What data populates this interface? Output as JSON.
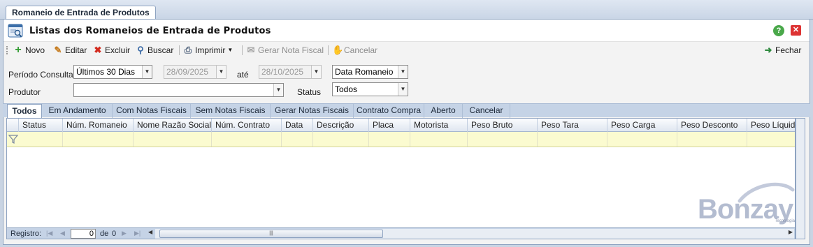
{
  "doc_tab": "Romaneio de Entrada de Produtos",
  "window": {
    "title": "Listas dos Romaneios de Entrada de Produtos"
  },
  "toolbar": {
    "novo": "Novo",
    "editar": "Editar",
    "excluir": "Excluir",
    "buscar": "Buscar",
    "imprimir": "Imprimir",
    "gerar_nf": "Gerar Nota Fiscal",
    "cancelar": "Cancelar",
    "fechar": "Fechar"
  },
  "filters": {
    "periodo_label": "Período Consulta",
    "periodo_value": "Últimos 30 Dias",
    "date_from": "28/09/2025",
    "ate_label": "até",
    "date_to": "28/10/2025",
    "date_type": "Data Romaneio",
    "produtor_label": "Produtor",
    "produtor_value": "",
    "status_label": "Status",
    "status_value": "Todos"
  },
  "grid_tabs": [
    "Todos",
    "Em Andamento",
    "Com Notas Fiscais",
    "Sem Notas Fiscais",
    "Gerar Notas Fiscais",
    "Contrato Compra",
    "Aberto",
    "Cancelar"
  ],
  "columns": [
    "Status",
    "Núm. Romaneio",
    "Nome Razão Social",
    "Núm. Contrato",
    "Data",
    "Descrição",
    "Placa",
    "Motorista",
    "Peso Bruto",
    "Peso Tara",
    "Peso Carga",
    "Peso Desconto",
    "Peso Líquido"
  ],
  "watermark": {
    "brand": "Bonzay",
    "sub": "Tecnologia"
  },
  "status_bar": {
    "registro_label": "Registro:",
    "current": "0",
    "de_label": "de",
    "total": "0"
  }
}
